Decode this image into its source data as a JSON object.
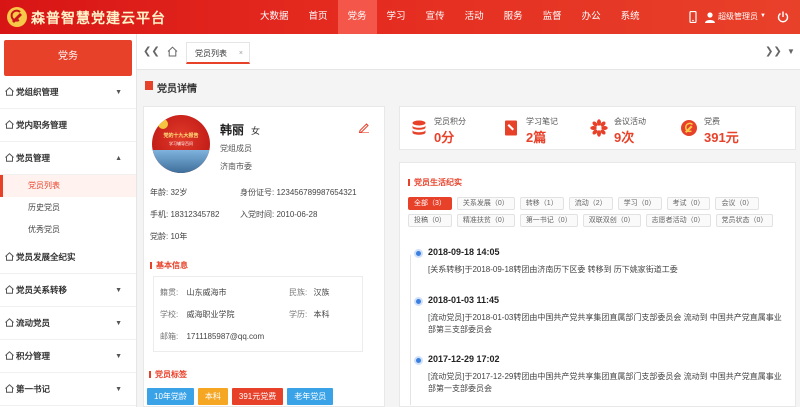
{
  "header": {
    "title": "森普智慧党建云平台",
    "nav": [
      "大数据",
      "首页",
      "党务",
      "学习",
      "宣传",
      "活动",
      "服务",
      "监督",
      "办公",
      "系统"
    ],
    "active_nav": "党务",
    "user_name": "超级管理员",
    "brand_color": "#d81515"
  },
  "sidebar": {
    "head": "党务",
    "groups": [
      {
        "label": "党组织管理",
        "arrow": "▼"
      },
      {
        "label": "党内职务管理",
        "arrow": ""
      },
      {
        "label": "党员管理",
        "arrow": "▲"
      },
      {
        "label": "党员发展全纪实",
        "arrow": ""
      },
      {
        "label": "党员关系转移",
        "arrow": "▼"
      },
      {
        "label": "流动党员",
        "arrow": "▼"
      },
      {
        "label": "积分管理",
        "arrow": "▼"
      },
      {
        "label": "第一书记",
        "arrow": "▼"
      }
    ],
    "sub_items": [
      "党员列表",
      "历史党员",
      "优秀党员"
    ],
    "active_sub": "党员列表"
  },
  "tabs": {
    "items": [
      {
        "label": "党员列表",
        "close": "×"
      }
    ]
  },
  "page": {
    "title": "党员详情"
  },
  "profile": {
    "avatar_text_1": "党的十九大报告",
    "avatar_text_2": "学习辅导百问",
    "name": "韩丽",
    "gender": "女",
    "role": "党组成员",
    "org": "济南市委",
    "age_label": "年龄:",
    "age": "32岁",
    "id_label": "身份证号:",
    "id_no": "123456789987654321",
    "phone_label": "手机:",
    "phone": "18312345782",
    "join_label": "入党时间:",
    "join_date": "2010-06-28",
    "party_age_label": "党龄:",
    "party_age": "10年",
    "basic_info_title": "基本信息",
    "basic_info": {
      "origin_label": "籍贯:",
      "origin": "山东威海市",
      "ethnic_label": "民族:",
      "ethnic": "汉族",
      "school_label": "学校:",
      "school": "威海职业学院",
      "degree_label": "学历:",
      "degree": "本科",
      "email_label": "邮箱:",
      "email": "1711185987@qq.com"
    },
    "tags_title": "党员标签",
    "tags": [
      {
        "label": "10年党龄",
        "color": "#3aa3e8"
      },
      {
        "label": "本科",
        "color": "#f5a623"
      },
      {
        "label": "391元党费",
        "color": "#e8412a"
      },
      {
        "label": "老年党员",
        "color": "#3aa3e8"
      }
    ]
  },
  "stats": [
    {
      "label": "党员积分",
      "value": "0分",
      "icon": "database-icon"
    },
    {
      "label": "学习笔记",
      "value": "2篇",
      "icon": "notebook-icon"
    },
    {
      "label": "会议活动",
      "value": "9次",
      "icon": "flower-icon"
    },
    {
      "label": "党费",
      "value": "391元",
      "icon": "party-emblem-icon"
    }
  ],
  "timeline": {
    "title": "党员生活纪实",
    "filters": [
      {
        "label": "全部（3）",
        "active": true
      },
      {
        "label": "关系发展（0）",
        "active": false
      },
      {
        "label": "转移（1）",
        "active": false
      },
      {
        "label": "流动（2）",
        "active": false
      },
      {
        "label": "学习（0）",
        "active": false
      },
      {
        "label": "考试（0）",
        "active": false
      },
      {
        "label": "会议（0）",
        "active": false
      },
      {
        "label": "投稿（0）",
        "active": false
      },
      {
        "label": "精准扶贫（0）",
        "active": false
      },
      {
        "label": "第一书记（0）",
        "active": false
      },
      {
        "label": "双联双创（0）",
        "active": false
      },
      {
        "label": "志愿者活动（0）",
        "active": false
      },
      {
        "label": "党员状态（0）",
        "active": false
      }
    ],
    "events": [
      {
        "date": "2018-09-18 14:05",
        "text": "[关系转移]于2018-09-18转团由济南历下区委 转移到 历下姚家街道工委"
      },
      {
        "date": "2018-01-03 11:45",
        "text": "[流动党员]于2018-01-03转团由中国共产党共享集团直属部门支部委员会 流动到 中国共产党直属事业部第三支部委员会"
      },
      {
        "date": "2017-12-29 17:02",
        "text": "[流动党员]于2017-12-29转团由中国共产党共享集团直属部门支部委员会 流动到 中国共产党直属事业部第一支部委员会"
      }
    ]
  }
}
